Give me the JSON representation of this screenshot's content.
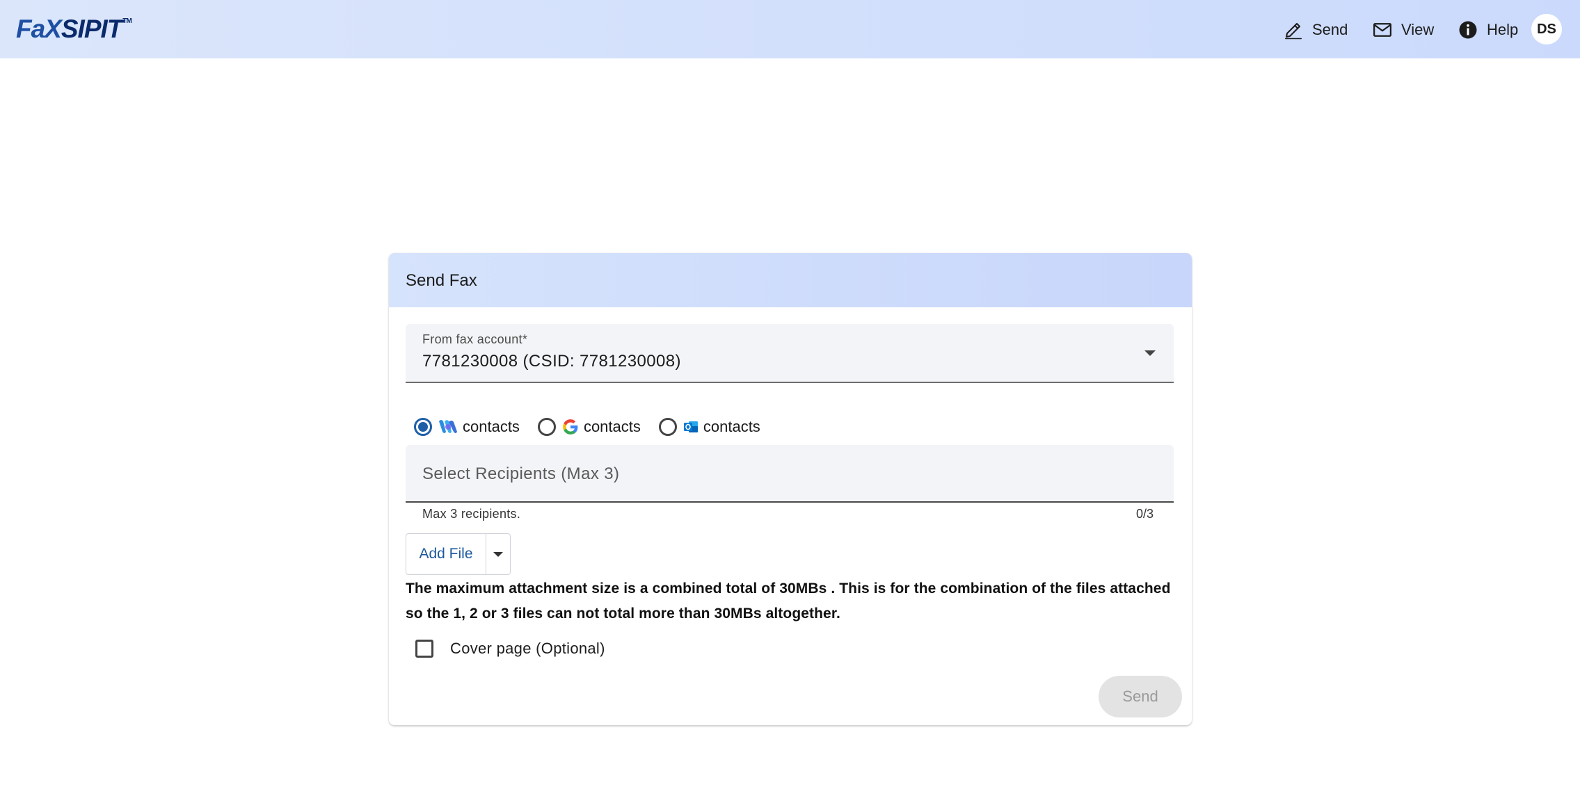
{
  "app": {
    "logo": {
      "fax": "FaX",
      "sip": "SIPIT",
      "tm": "TM"
    }
  },
  "nav": {
    "send_label": "Send",
    "view_label": "View",
    "help_label": "Help",
    "avatar_initials": "DS"
  },
  "card": {
    "title": "Send Fax",
    "from_account": {
      "label": "From fax account*",
      "value": "7781230008 (CSID: 7781230008)"
    },
    "contact_sources": [
      {
        "icon": "webex-icon",
        "label": "contacts",
        "selected": true
      },
      {
        "icon": "google-icon",
        "label": "contacts",
        "selected": false
      },
      {
        "icon": "outlook-icon",
        "label": "contacts",
        "selected": false
      }
    ],
    "recipients": {
      "placeholder": "Select Recipients (Max 3)",
      "hint": "Max 3 recipients.",
      "counter": "0/3"
    },
    "add_file_label": "Add File",
    "notice": "The maximum attachment size is a combined total of 30MBs . This is for the combination of the files attached so the 1, 2 or 3 files can not total more than 30MBs altogether.",
    "cover_page": {
      "label": "Cover page (Optional)",
      "checked": false
    },
    "send_label": "Send",
    "send_disabled": true
  },
  "colors": {
    "accent": "#1f5fa8",
    "header_gradient_start": "#dbe6fb",
    "header_gradient_end": "#cbdafc",
    "field_background": "#f3f4f7",
    "disabled_button": "#e3e3e3"
  }
}
